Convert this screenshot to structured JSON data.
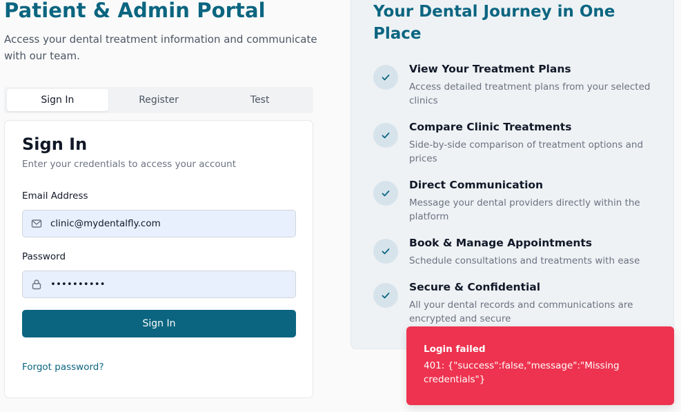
{
  "header": {
    "title": "Patient & Admin Portal",
    "subtitle": "Access your dental treatment information and communicate with our team."
  },
  "tabs": [
    {
      "label": "Sign In",
      "active": true
    },
    {
      "label": "Register",
      "active": false
    },
    {
      "label": "Test",
      "active": false
    }
  ],
  "signin": {
    "title": "Sign In",
    "subtitle": "Enter your credentials to access your account",
    "email_label": "Email Address",
    "email_value": "clinic@mydentalfly.com",
    "email_icon": "mail-icon",
    "password_label": "Password",
    "password_value": "••••••••••",
    "password_icon": "lock-icon",
    "submit_label": "Sign In",
    "forgot_label": "Forgot password?"
  },
  "features": {
    "title": "Your Dental Journey in One Place",
    "items": [
      {
        "title": "View Your Treatment Plans",
        "desc": "Access detailed treatment plans from your selected clinics"
      },
      {
        "title": "Compare Clinic Treatments",
        "desc": "Side-by-side comparison of treatment options and prices"
      },
      {
        "title": "Direct Communication",
        "desc": "Message your dental providers directly within the platform"
      },
      {
        "title": "Book & Manage Appointments",
        "desc": "Schedule consultations and treatments with ease"
      },
      {
        "title": "Secure & Confidential",
        "desc": "All your dental records and communications are encrypted and secure"
      }
    ]
  },
  "toast": {
    "title": "Login failed",
    "message": "401: {\"success\":false,\"message\":\"Missing credentials\"}"
  },
  "colors": {
    "brand": "#0b6580",
    "toast_bg": "#ed334f",
    "input_bg": "#e8f0fe"
  }
}
